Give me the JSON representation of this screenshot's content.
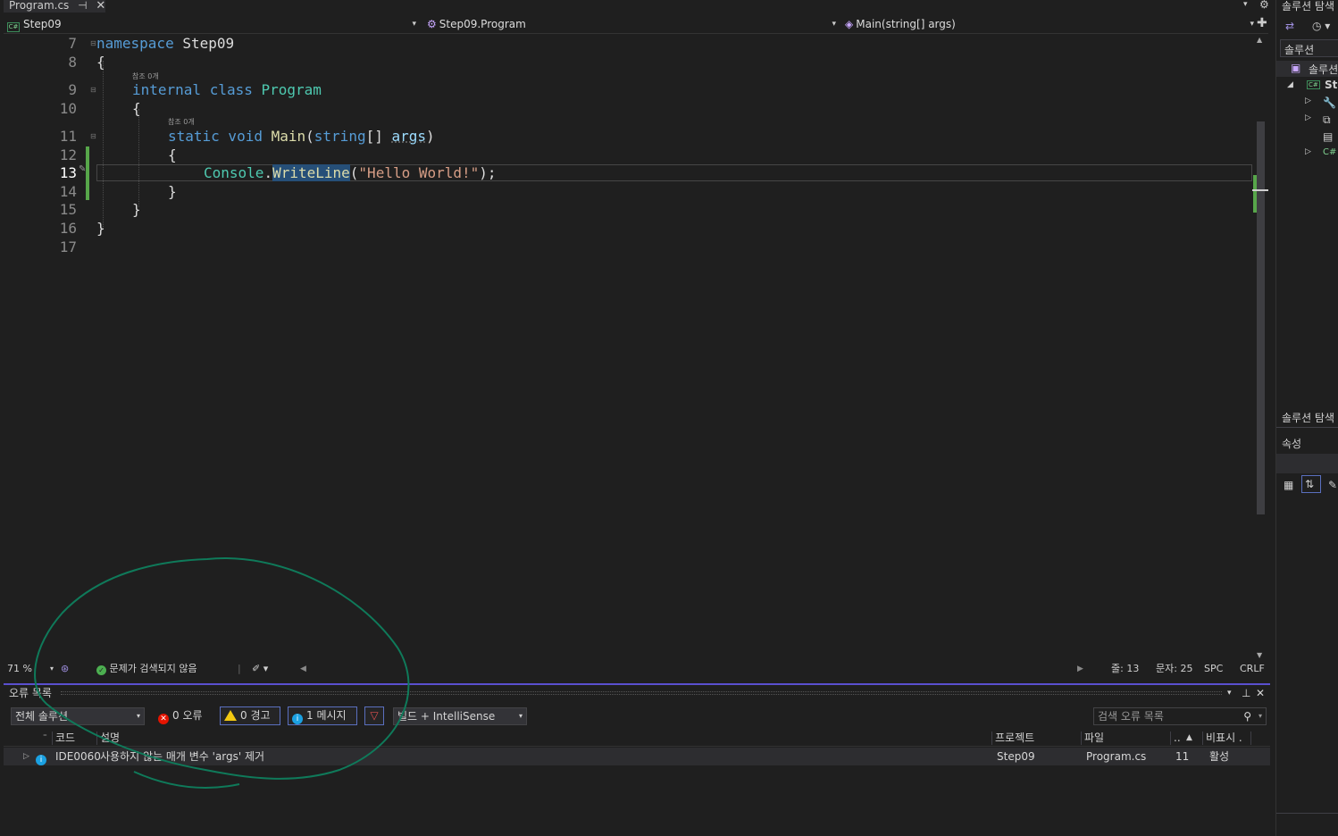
{
  "tab": {
    "title": "Program.cs",
    "pin": "⊣",
    "close": "✕"
  },
  "navbar": {
    "project": "Step09",
    "class": "Step09.Program",
    "member": "Main(string[] args)"
  },
  "editor": {
    "line_numbers": [
      "7",
      "8",
      "9",
      "10",
      "11",
      "12",
      "13",
      "14",
      "15",
      "16",
      "17"
    ],
    "code": {
      "l7_kw": "namespace",
      "l7_name": " Step09",
      "l8": "{",
      "lens1": "참조 0개",
      "l9_kw1": "internal",
      "l9_kw2": " class",
      "l9_ty": " Program",
      "l10": "{",
      "lens2": "참조 0개",
      "l11_kw1": "static",
      "l11_kw2": " void",
      "l11_mth": " Main",
      "l11_p1": "(",
      "l11_kw3": "string",
      "l11_p2": "[] ",
      "l11_par": "args",
      "l11_p3": ")",
      "l12": "{",
      "l13_ty": "Console",
      "l13_dot": ".",
      "l13_mth": "WriteLine",
      "l13_p1": "(",
      "l13_str": "\"Hello World!\"",
      "l13_p2": ");",
      "l14": "}",
      "l15": "}",
      "l16": "}"
    }
  },
  "edstatus": {
    "zoom": "71 %",
    "issues": "문제가 검색되지 않음",
    "line": "줄: 13",
    "char": "문자: 25",
    "spc": "SPC",
    "crlf": "CRLF"
  },
  "errorlist": {
    "title": "오류 목록",
    "scope": "전체 솔루션",
    "errors": "0 오류",
    "warnings": "0 경고",
    "messages": "1 메시지",
    "source": "빌드 + IntelliSense",
    "search_placeholder": "검색 오류 목록",
    "columns": {
      "code": "코드",
      "desc": "설명",
      "project": "프로젝트",
      "file": "파일",
      "line": "..",
      "suppress": "비표시 ."
    },
    "rows": [
      {
        "code": "IDE0060",
        "desc": "사용하지 않는 매개 변수 'args' 제거",
        "project": "Step09",
        "file": "Program.cs",
        "line": "11",
        "suppress": "활성"
      }
    ]
  },
  "rightpanel": {
    "title": "솔루션 탐색",
    "search": "솔루션",
    "root": "솔루션",
    "project": "Ste",
    "cs": "C#",
    "bottom_title": "솔루션 탐색",
    "properties": "속성"
  },
  "colors": {
    "accent": "#5a4fcf",
    "keyword": "#569cd6",
    "type": "#4ec9b0",
    "string": "#d69d85",
    "annotation": "#0f7a5a"
  }
}
